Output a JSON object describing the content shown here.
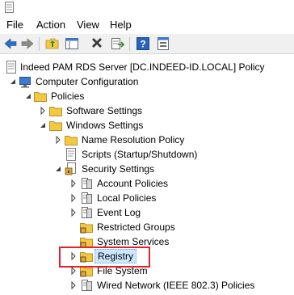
{
  "menu": {
    "file": "File",
    "action": "Action",
    "view": "View",
    "help": "Help"
  },
  "toolbar": {
    "buttons": [
      "back-icon",
      "forward-icon",
      "up-folder-icon",
      "show-hide-tree-icon",
      "delete-icon",
      "export-list-icon",
      "help-icon",
      "properties-icon"
    ]
  },
  "tree": {
    "root": "Indeed PAM RDS Server [DC.INDEED-ID.LOCAL] Policy",
    "computer_configuration": "Computer Configuration",
    "policies": "Policies",
    "software_settings": "Software Settings",
    "windows_settings": "Windows Settings",
    "name_resolution_policy": "Name Resolution Policy",
    "scripts": "Scripts (Startup/Shutdown)",
    "security_settings": "Security Settings",
    "account_policies": "Account Policies",
    "local_policies": "Local Policies",
    "event_log": "Event Log",
    "restricted_groups": "Restricted Groups",
    "system_services": "System Services",
    "registry": "Registry",
    "file_system": "File System",
    "wired_network": "Wired Network (IEEE 802.3) Policies"
  },
  "colors": {
    "selection_bg": "#cce8ff",
    "highlight_border": "#e2212b",
    "folder_yellow": "#f5c842"
  }
}
